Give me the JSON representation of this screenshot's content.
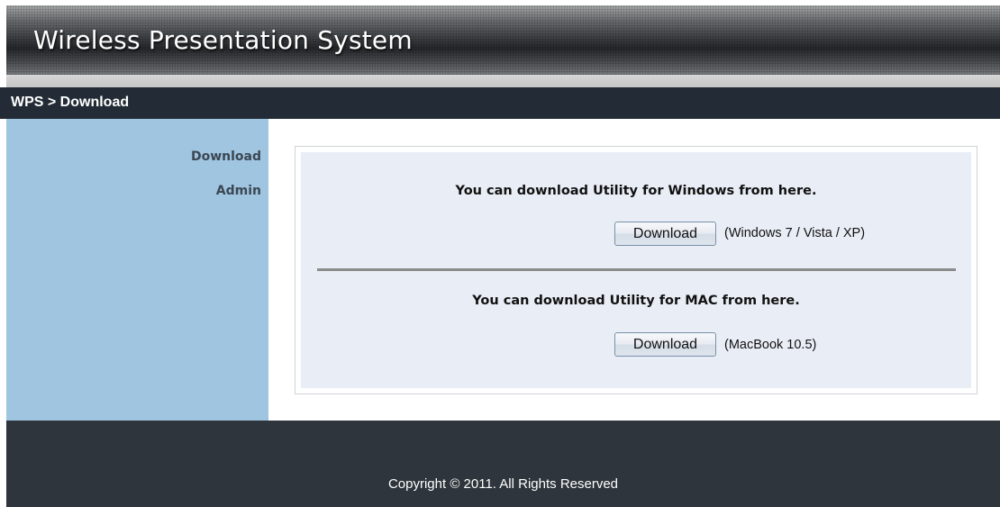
{
  "header": {
    "title": "Wireless Presentation System"
  },
  "breadcrumb": {
    "text": "WPS > Download"
  },
  "sidebar": {
    "items": [
      {
        "label": "Download"
      },
      {
        "label": "Admin"
      }
    ]
  },
  "main": {
    "windows": {
      "heading": "You can download Utility for Windows from here.",
      "button_label": "Download",
      "note": "(Windows 7 / Vista / XP)"
    },
    "mac": {
      "heading": "You can download Utility for MAC from here.",
      "button_label": "Download",
      "note": "(MacBook 10.5)"
    }
  },
  "footer": {
    "copyright": "Copyright © 2011. All Rights Reserved"
  },
  "colors": {
    "breadcrumb_bar": "#232c36",
    "sidebar": "#9fc5e1",
    "panel": "#e9eef6",
    "footer": "#2e353c"
  }
}
